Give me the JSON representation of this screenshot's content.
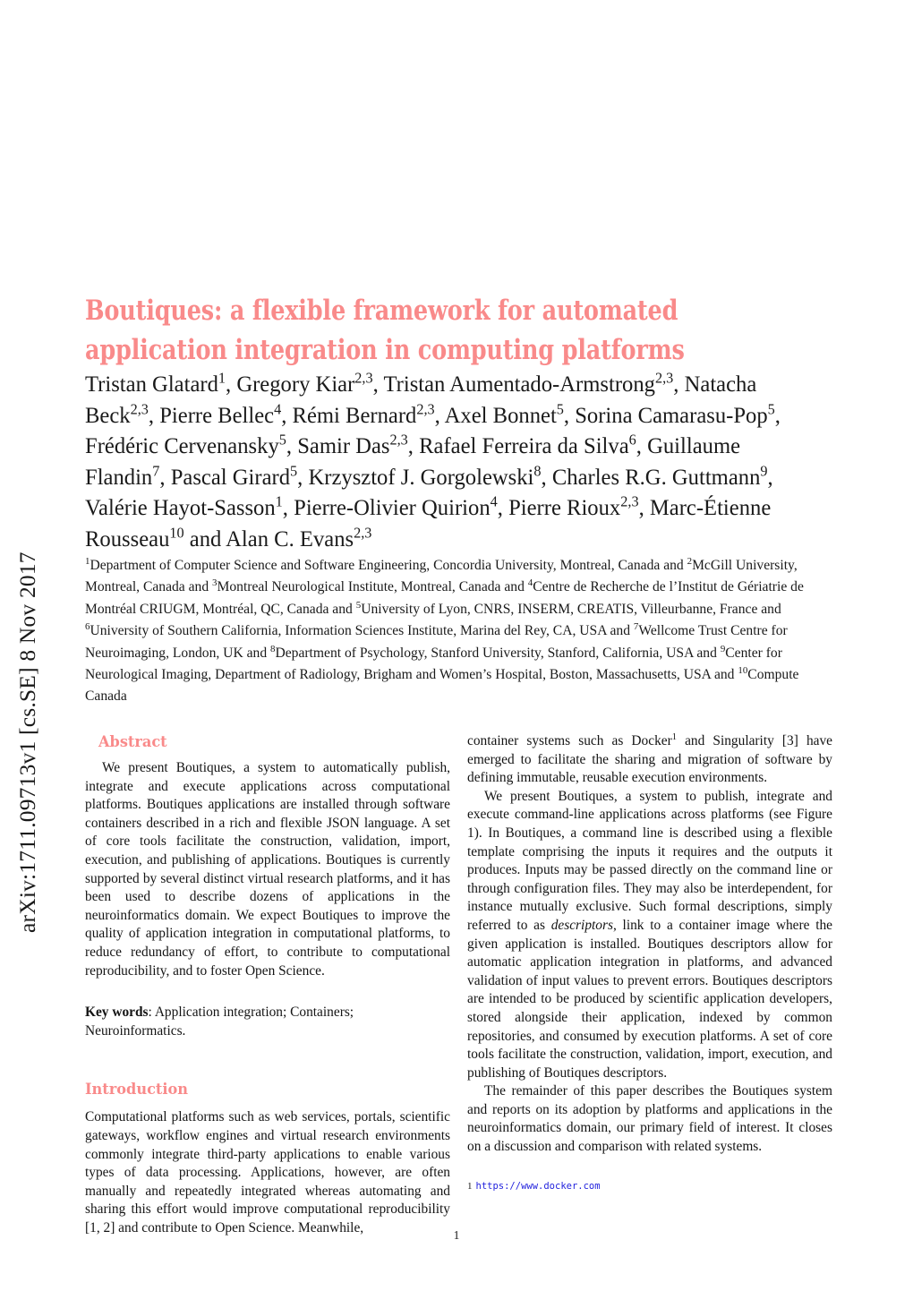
{
  "arxiv": {
    "stamp": "arXiv:1711.09713v1  [cs.SE]  8 Nov 2017"
  },
  "paper": {
    "title_line1": "Boutiques: a flexible framework for automated",
    "title_line2": "application integration in computing platforms",
    "authors_html": "Tristan Glatard<sup>1</sup>, Gregory Kiar<sup>2,3</sup>, Tristan Aumentado-Armstrong<sup>2,3</sup>, Natacha Beck<sup>2,3</sup>, Pierre Bellec<sup>4</sup>, R&eacute;mi Bernard<sup>2,3</sup>, Axel Bonnet<sup>5</sup>, Sorina Camarasu-Pop<sup>5</sup>, Fr&eacute;d&eacute;ric Cervenansky<sup>5</sup>, Samir Das<sup>2,3</sup>, Rafael Ferreira da Silva<sup>6</sup>, Guillaume Flandin<sup>7</sup>, Pascal Girard<sup>5</sup>, Krzysztof J. Gorgolewski<sup>8</sup>, Charles R.G. Guttmann<sup>9</sup>, Val&eacute;rie Hayot-Sasson<sup>1</sup>, Pierre-Olivier Quirion<sup>4</sup>, Pierre Rioux<sup>2,3</sup>, Marc-&Eacute;tienne Rousseau<sup>10</sup> and Alan C. Evans<sup>2,3</sup>",
    "affiliations_html": "<sup>1</sup>Department of Computer Science and Software Engineering, Concordia University, Montreal, Canada and <sup>2</sup>McGill University, Montreal, Canada and <sup>3</sup>Montreal Neurological Institute, Montreal, Canada and <sup>4</sup>Centre de Recherche de l&rsquo;Institut de G&eacute;riatrie de Montr&eacute;al CRIUGM, Montr&eacute;al, QC, Canada and <sup>5</sup>University of Lyon, CNRS, INSERM, CREATIS, Villeurbanne, France and <sup>6</sup>University of Southern California, Information Sciences Institute, Marina del Rey, CA, USA and <sup>7</sup>Wellcome Trust Centre for Neuroimaging, London, UK and <sup>8</sup>Department of Psychology, Stanford University, Stanford, California, USA and <sup>9</sup>Center for Neurological Imaging, Department of Radiology, Brigham and Women&rsquo;s Hospital, Boston, Massachusetts, USA and <sup>10</sup>Compute Canada",
    "page_number": "1"
  },
  "sections": {
    "abstract_heading": "Abstract",
    "abstract_text": "We present Boutiques, a system to automatically publish, integrate and execute applications across computational platforms.  Boutiques applications are installed through software containers described in a rich and flexible JSON language. A set of core tools facilitate the construction, validation, import, execution, and publishing of applications. Boutiques is currently supported by several distinct virtual research platforms, and it has been used to describe dozens of applications in the neuroinformatics domain. We expect Boutiques to improve the quality of application integration in computational platforms, to reduce redundancy of effort, to contribute to computational reproducibility, and to foster Open Science.",
    "keywords_label": "Key words",
    "keywords_value": ": Application integration; Containers; Neuroinformatics.",
    "introduction_heading": "Introduction",
    "intro_para1": "Computational platforms such as web services, portals, scientific gateways, workflow engines and virtual research environments commonly integrate third-party applications to enable various types of data processing.  Applications, however, are often manually and repeatedly integrated whereas automating and sharing this effort would improve computational reproducibility [1, 2] and contribute to Open Science.  Meanwhile,",
    "right_para1_html": "container systems such as Docker<sup class=\"fn\">1</sup> and Singularity [3] have emerged to facilitate the sharing and migration of software by defining immutable, reusable execution environments.",
    "right_para2_html": "We present Boutiques, a system to publish, integrate and execute command-line applications across platforms (see Figure 1). In Boutiques, a command line is described using a flexible template comprising the inputs it requires and the outputs it produces.  Inputs may be passed directly on the command line or through configuration files.  They may also be interdependent, for instance mutually exclusive.  Such formal descriptions, simply referred to as <em class=\"ital\">descriptors</em>, link to a container image where the given application is installed.  Boutiques descriptors allow for automatic application integration in platforms, and advanced validation of input values to prevent errors. Boutiques descriptors are intended to be produced by scientific application developers, stored alongside their application, indexed by common repositories, and consumed by execution platforms. A set of core tools facilitate the construction, validation, import, execution, and publishing of Boutiques descriptors.",
    "right_para3": "The remainder of this paper describes the Boutiques system and reports on its adoption by platforms and applications in the neuroinformatics domain, our primary field of interest. It closes on a discussion and comparison with related systems."
  },
  "footnote": {
    "number": "1",
    "url": "https://www.docker.com"
  },
  "colors": {
    "accent": "#f98a8a",
    "body_text": "#141414",
    "link": "#2222dd"
  }
}
